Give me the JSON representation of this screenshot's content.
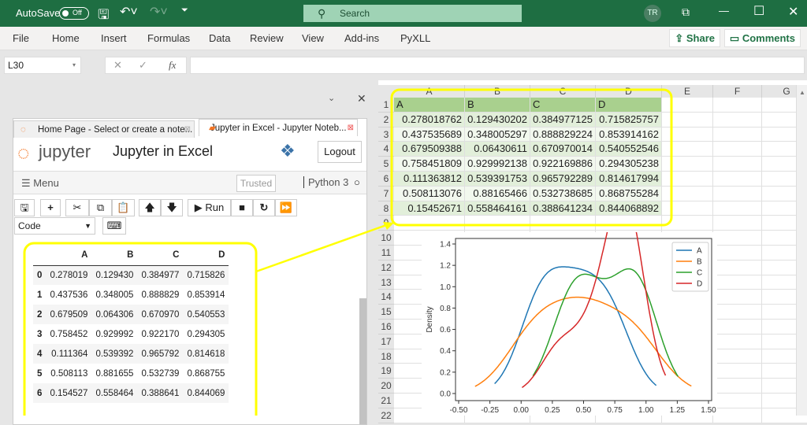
{
  "titlebar": {
    "autosave": "AutoSave",
    "toggle": "Off",
    "search": "Search",
    "avatar": "TR"
  },
  "ribbon": {
    "tabs": [
      "File",
      "Home",
      "Insert",
      "Formulas",
      "Data",
      "Review",
      "View",
      "Add-ins",
      "PyXLL"
    ],
    "share": "Share",
    "comments": "Comments"
  },
  "formula_bar": {
    "name_box": "L30",
    "fx": "fx",
    "formula": ""
  },
  "notebook": {
    "tabs": [
      "Home Page - Select or create a note...",
      "Jupyter in Excel - Jupyter Noteb..."
    ],
    "logo": "jupyter",
    "title": "Jupyter in Excel",
    "logout": "Logout",
    "menu": "Menu",
    "trusted": "Trusted",
    "kernel": "Python 3",
    "run": "Run",
    "cell_type": "Code",
    "df_columns": [
      "A",
      "B",
      "C",
      "D"
    ],
    "df_rows": [
      [
        "0",
        "0.278019",
        "0.129430",
        "0.384977",
        "0.715826"
      ],
      [
        "1",
        "0.437536",
        "0.348005",
        "0.888829",
        "0.853914"
      ],
      [
        "2",
        "0.679509",
        "0.064306",
        "0.670970",
        "0.540553"
      ],
      [
        "3",
        "0.758452",
        "0.929992",
        "0.922170",
        "0.294305"
      ],
      [
        "4",
        "0.111364",
        "0.539392",
        "0.965792",
        "0.814618"
      ],
      [
        "5",
        "0.508113",
        "0.881655",
        "0.532739",
        "0.868755"
      ],
      [
        "6",
        "0.154527",
        "0.558464",
        "0.388641",
        "0.844069"
      ]
    ]
  },
  "sheet": {
    "columns": [
      "A",
      "B",
      "C",
      "D",
      "E",
      "F",
      "G"
    ],
    "rows": [
      "1",
      "2",
      "3",
      "4",
      "5",
      "6",
      "7",
      "8",
      "9",
      "10",
      "11",
      "12",
      "13",
      "14",
      "15",
      "16",
      "17",
      "18",
      "19",
      "20",
      "21",
      "22"
    ],
    "header": [
      "A",
      "B",
      "C",
      "D"
    ],
    "cells": [
      [
        "0.278018762",
        "0.129430202",
        "0.384977125",
        "0.715825757"
      ],
      [
        "0.437535689",
        "0.348005297",
        "0.888829224",
        "0.853914162"
      ],
      [
        "0.679509388",
        "0.06430611",
        "0.670970014",
        "0.540552546"
      ],
      [
        "0.758451809",
        "0.929992138",
        "0.922169886",
        "0.294305238"
      ],
      [
        "0.111363812",
        "0.539391753",
        "0.965792289",
        "0.814617994"
      ],
      [
        "0.508113076",
        "0.88165466",
        "0.532738685",
        "0.868755284"
      ],
      [
        "0.15452671",
        "0.558464161",
        "0.388641234",
        "0.844068892"
      ]
    ]
  },
  "chart_data": {
    "type": "line",
    "kind": "kde",
    "ylabel": "Density",
    "xlabel": "",
    "xlim": [
      -0.5,
      1.5
    ],
    "ylim": [
      0,
      1.4
    ],
    "xticks": [
      "-0.50",
      "-0.25",
      "0.00",
      "0.25",
      "0.50",
      "0.75",
      "1.00",
      "1.25",
      "1.50"
    ],
    "yticks": [
      "0.0",
      "0.2",
      "0.4",
      "0.6",
      "0.8",
      "1.0",
      "1.2",
      "1.4"
    ],
    "legend_position": "top-right",
    "series": [
      {
        "name": "A",
        "color": "#1f77b4",
        "samples": [
          0.278018762,
          0.437535689,
          0.679509388,
          0.758451809,
          0.111363812,
          0.508113076,
          0.15452671
        ]
      },
      {
        "name": "B",
        "color": "#ff7f0e",
        "samples": [
          0.129430202,
          0.348005297,
          0.06430611,
          0.929992138,
          0.539391753,
          0.88165466,
          0.558464161
        ]
      },
      {
        "name": "C",
        "color": "#2ca02c",
        "samples": [
          0.384977125,
          0.888829224,
          0.670970014,
          0.922169886,
          0.965792289,
          0.532738685,
          0.388641234
        ]
      },
      {
        "name": "D",
        "color": "#d62728",
        "samples": [
          0.715825757,
          0.853914162,
          0.540552546,
          0.294305238,
          0.814617994,
          0.868755284,
          0.844068892
        ]
      }
    ]
  },
  "colors": {
    "excel_green": "#1e6e42",
    "header_fill": "#a9d08e",
    "band_fill": "#e2efda",
    "callout": "#ffff00"
  }
}
